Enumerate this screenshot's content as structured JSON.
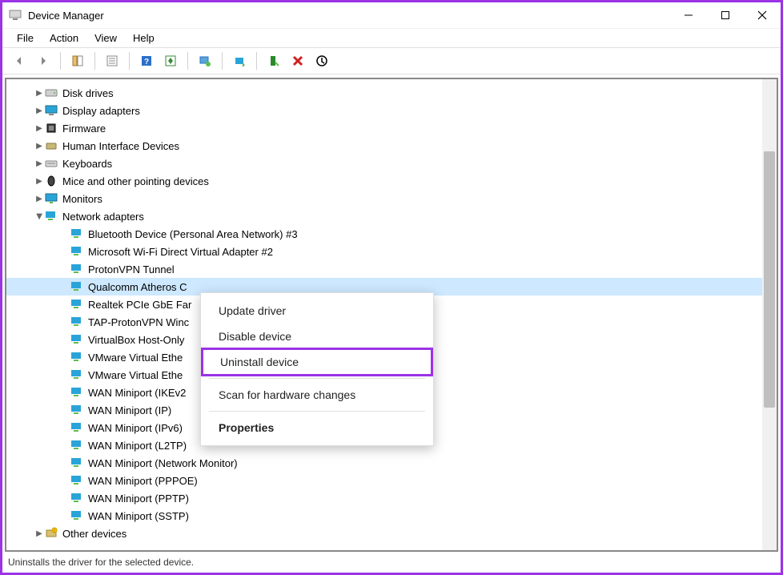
{
  "window": {
    "title": "Device Manager"
  },
  "menubar": [
    "File",
    "Action",
    "View",
    "Help"
  ],
  "tree": {
    "collapsed": [
      {
        "label": "Disk drives",
        "icon": "disk"
      },
      {
        "label": "Display adapters",
        "icon": "display"
      },
      {
        "label": "Firmware",
        "icon": "firmware"
      },
      {
        "label": "Human Interface Devices",
        "icon": "hid"
      },
      {
        "label": "Keyboards",
        "icon": "keyboard"
      },
      {
        "label": "Mice and other pointing devices",
        "icon": "mouse"
      },
      {
        "label": "Monitors",
        "icon": "monitor"
      }
    ],
    "network_label": "Network adapters",
    "network_children": [
      "Bluetooth Device (Personal Area Network) #3",
      "Microsoft Wi-Fi Direct Virtual Adapter #2",
      "ProtonVPN Tunnel",
      "Qualcomm Atheros C",
      "Realtek PCIe GbE Far",
      "TAP-ProtonVPN Winc",
      "VirtualBox Host-Only",
      "VMware Virtual Ethe",
      "VMware Virtual Ethe",
      "WAN Miniport (IKEv2",
      "WAN Miniport (IP)",
      "WAN Miniport (IPv6)",
      "WAN Miniport (L2TP)",
      "WAN Miniport (Network Monitor)",
      "WAN Miniport (PPPOE)",
      "WAN Miniport (PPTP)",
      "WAN Miniport (SSTP)"
    ],
    "selected_index": 3,
    "other_label": "Other devices"
  },
  "context_menu": {
    "items": [
      {
        "label": "Update driver"
      },
      {
        "label": "Disable device"
      },
      {
        "label": "Uninstall device",
        "highlighted": true
      },
      {
        "sep": true
      },
      {
        "label": "Scan for hardware changes"
      },
      {
        "sep": true
      },
      {
        "label": "Properties",
        "bold": true
      }
    ]
  },
  "statusbar": "Uninstalls the driver for the selected device."
}
